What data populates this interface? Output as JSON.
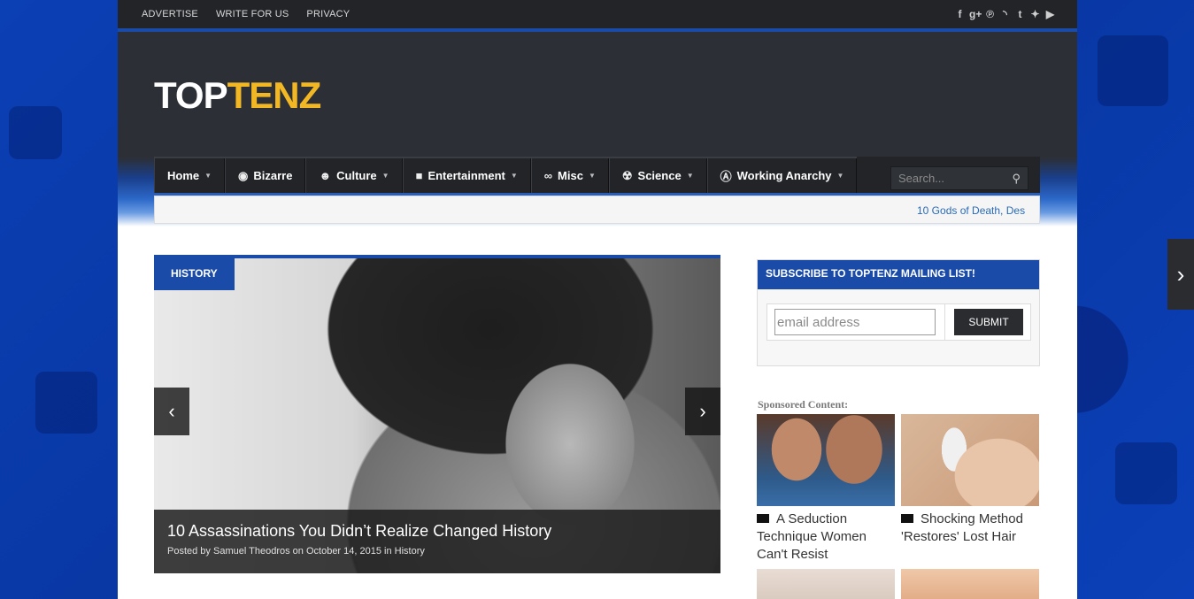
{
  "topbar": {
    "links": [
      "ADVERTISE",
      "WRITE FOR US",
      "PRIVACY"
    ],
    "social_icons": [
      "facebook-icon",
      "google-plus-icon",
      "pinterest-icon",
      "rss-icon",
      "tumblr-icon",
      "twitter-icon",
      "youtube-icon"
    ]
  },
  "logo": {
    "part1": "TOP",
    "part2": "TENZ"
  },
  "nav": {
    "items": [
      {
        "label": "Home",
        "icon": "",
        "has_caret": true
      },
      {
        "label": "Bizarre",
        "icon": "eye-icon",
        "has_caret": false
      },
      {
        "label": "Culture",
        "icon": "mask-icon",
        "has_caret": true
      },
      {
        "label": "Entertainment",
        "icon": "camera-icon",
        "has_caret": true
      },
      {
        "label": "Misc",
        "icon": "infinity-icon",
        "has_caret": true
      },
      {
        "label": "Science",
        "icon": "radiation-icon",
        "has_caret": true
      },
      {
        "label": "Working Anarchy",
        "icon": "anarchy-icon",
        "has_caret": true
      }
    ],
    "search_placeholder": "Search..."
  },
  "ticker": {
    "text": "10 Gods of Death, Des"
  },
  "featured": {
    "category": "HISTORY",
    "title": "10 Assassinations You Didn’t Realize Changed History",
    "meta_prefix": "Posted by ",
    "author": "Samuel Theodros",
    "meta_on": " on ",
    "date": "October 14, 2015",
    "meta_in": " in ",
    "meta_category": "History"
  },
  "subscribe": {
    "heading": "SUBSCRIBE TO TOPTENZ MAILING LIST!",
    "email_placeholder": "email address",
    "submit_label": "SUBMIT"
  },
  "sponsored": {
    "label": "Sponsored Content:",
    "items": [
      {
        "title": "A Seduction Technique Women Can't Resist"
      },
      {
        "title": "Shocking Method 'Restores' Lost Hair"
      }
    ]
  },
  "colors": {
    "accent": "#1a4ba8",
    "logo_yellow": "#f2b724",
    "header_bg": "#2c2f35",
    "nav_bg": "#222428"
  }
}
